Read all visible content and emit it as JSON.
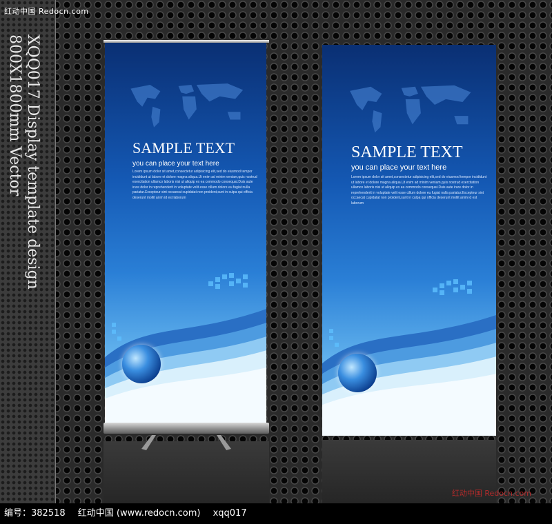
{
  "watermark_top": "红动中国 Redocn.com",
  "vertical_text": [
    "XQQ017 Display template design",
    "800X1800mm Vector"
  ],
  "banners": [
    {
      "title": "SAMPLE TEXT",
      "subtitle": "you can place your text here",
      "lorem": "Lorem ipsum dolor sit amet,consectetur adipisicing elit,sed do eiusmod tempor incididunt ut labore et dolore magna aliqua.Ut enim ad minim veniam,quis nostrud exercitation ullamco laboris nisi ut aliquip ex ea commodo consequat.Duis aute irure dolor in reprehenderit in voluptate velit esse cillum dolore eu fugiat nulla pariatur.Excepteur sint occaecat cupidatat non proident,sunt in culpa qui officia deserunt mollit anim id est laborum"
    },
    {
      "title": "SAMPLE TEXT",
      "subtitle": "you can place your text here",
      "lorem": "Lorem ipsum dolor sit amet,consectetur adipisicing elit,sed do eiusmod tempor incididunt ut labore et dolore magna aliqua.Ut enim ad minim veniam,quis nostrud exercitation ullamco laboris nisi ut aliquip ex ea commodo consequat.Duis aute irure dolor in reprehenderit in voluptate velit esse cillum dolore eu fugiat nulla pariatur.Excepteur sint occaecat cupidatat non proident,sunt in culpa qui officia deserunt mollit anim id est laborum"
    }
  ],
  "footer": {
    "id_text": "编号：382518",
    "site_text": "红动中国 (www.redocn.com)",
    "code_text": "xqq017"
  },
  "watermark_bottom": "红动中国 Redocn.com",
  "colors": {
    "banner_dark": "#0a2f73",
    "banner_light": "#cfe9fb",
    "watermark_red": "#cc2b2b"
  }
}
